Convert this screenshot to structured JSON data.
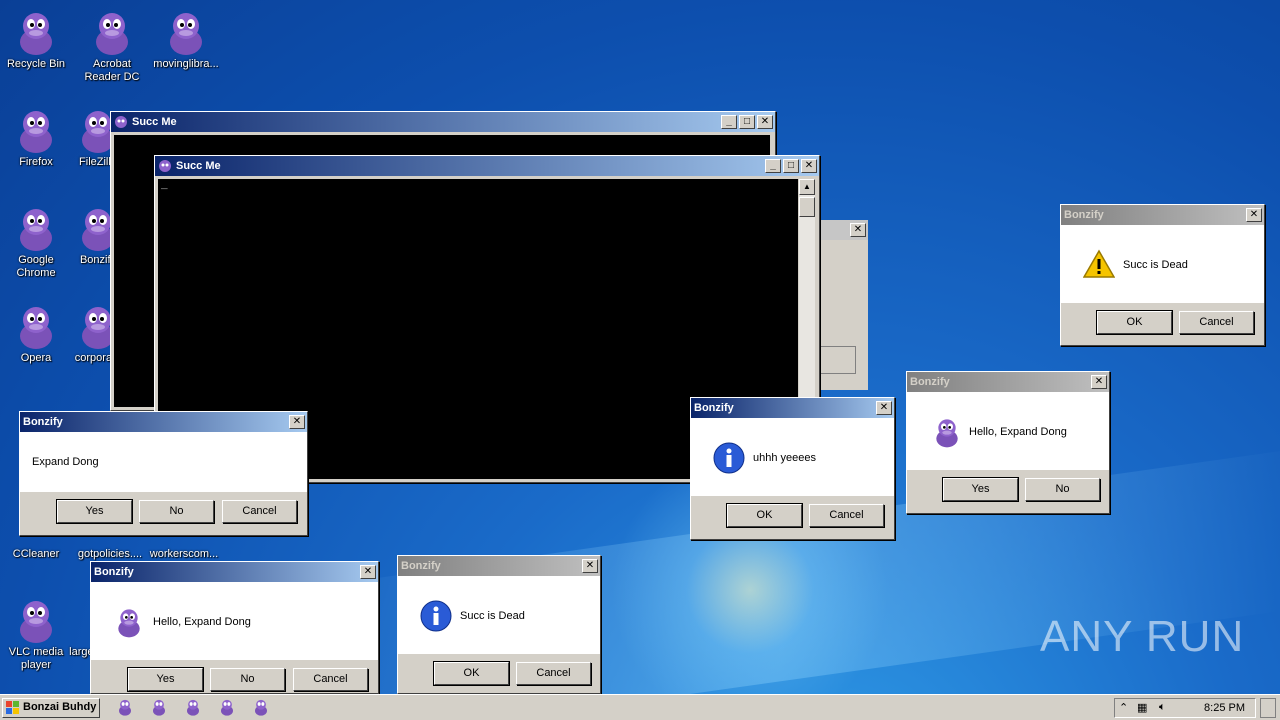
{
  "desktop": {
    "icons": [
      {
        "label": "Recycle Bin"
      },
      {
        "label": "Acrobat Reader DC"
      },
      {
        "label": "movinglibra..."
      },
      {
        "label": "Firefox"
      },
      {
        "label": "FileZilla"
      },
      {
        "label": "Google Chrome"
      },
      {
        "label": "Bonzify"
      },
      {
        "label": "Opera"
      },
      {
        "label": "corpora..."
      },
      {
        "label": "CCleaner"
      },
      {
        "label": "gotpolicies...."
      },
      {
        "label": "workerscom..."
      },
      {
        "label": "VLC media player"
      },
      {
        "label": "large..."
      }
    ]
  },
  "console_back": {
    "title": "Succ Me"
  },
  "console_front": {
    "title": "Succ Me",
    "cursor": "_"
  },
  "dialogs": {
    "warn": {
      "title": "Bonzify",
      "message": "Succ is Dead",
      "ok": "OK",
      "cancel": "Cancel"
    },
    "hello_right": {
      "title": "Bonzify",
      "message": "Hello, Expand Dong",
      "yes": "Yes",
      "no": "No"
    },
    "uhhh": {
      "title": "Bonzify",
      "message": "uhhh yeeees",
      "ok": "OK",
      "cancel": "Cancel"
    },
    "expand": {
      "title": "Bonzify",
      "message": "Expand Dong",
      "yes": "Yes",
      "no": "No",
      "cancel": "Cancel"
    },
    "hello_bottom": {
      "title": "Bonzify",
      "message": "Hello, Expand Dong",
      "yes": "Yes",
      "no": "No",
      "cancel": "Cancel"
    },
    "succ_info": {
      "title": "Bonzify",
      "message": "Succ is Dead",
      "ok": "OK",
      "cancel": "Cancel"
    }
  },
  "taskbar": {
    "start_label": "Bonzai Buhdy",
    "clock": "8:25 PM",
    "quick_launch": [
      "bonzi-icon",
      "bonzi-icon",
      "bonzi-icon",
      "bonzi-icon",
      "bonzi-icon"
    ]
  },
  "watermark": "ANY RUN",
  "colors": {
    "titlebar_active": "#0a246a",
    "titlebar_inactive": "#808080",
    "desktop": "#1a6bc9"
  }
}
